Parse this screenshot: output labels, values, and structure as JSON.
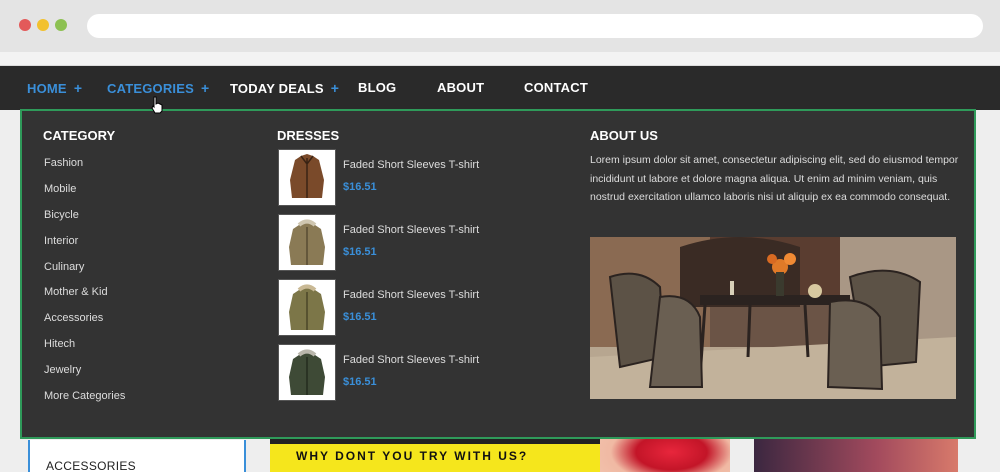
{
  "nav": {
    "items": [
      {
        "label": "HOME",
        "has_plus": true,
        "active": true
      },
      {
        "label": "CATEGORIES",
        "has_plus": true,
        "active": true
      },
      {
        "label": "TODAY DEALS",
        "has_plus": true,
        "active": false
      },
      {
        "label": "BLOG",
        "has_plus": false,
        "active": false
      },
      {
        "label": "ABOUT",
        "has_plus": false,
        "active": false
      },
      {
        "label": "CONTACT",
        "has_plus": false,
        "active": false
      }
    ],
    "plus": "+"
  },
  "menu": {
    "category": {
      "title": "CATEGORY",
      "items": [
        "Fashion",
        "Mobile",
        "Bicycle",
        "Interior",
        "Culinary",
        "Mother & Kid",
        "Accessories",
        "Hitech",
        "Jewelry",
        "More Categories"
      ]
    },
    "dresses": {
      "title": "DRESSES",
      "products": [
        {
          "name": "Faded Short Sleeves T-shirt",
          "price": "$16.51",
          "jacket_color": "#7a4a2a"
        },
        {
          "name": "Faded Short Sleeves T-shirt",
          "price": "$16.51",
          "jacket_color": "#8a7a55"
        },
        {
          "name": "Faded Short Sleeves T-shirt",
          "price": "$16.51",
          "jacket_color": "#7c7648"
        },
        {
          "name": "Faded Short Sleeves T-shirt",
          "price": "$16.51",
          "jacket_color": "#3e4a36"
        }
      ]
    },
    "about": {
      "title": "ABOUT US",
      "text": "Lorem ipsum dolor sit amet, consectetur adipiscing elit, sed do eiusmod tempor incididunt ut labore et dolore magna aliqua. Ut enim ad minim veniam, quis nostrud exercitation ullamco laboris nisi ut aliquip ex ea commodo consequat."
    }
  },
  "page": {
    "sidebar_label": "ACCESSORIES",
    "banner_tagline": "WHY DONT YOU TRY WITH US?"
  },
  "colors": {
    "accent": "#3a8fd9",
    "nav_bg": "#2a2a2a",
    "menu_bg": "#333333",
    "menu_border": "#2f9a5a"
  }
}
